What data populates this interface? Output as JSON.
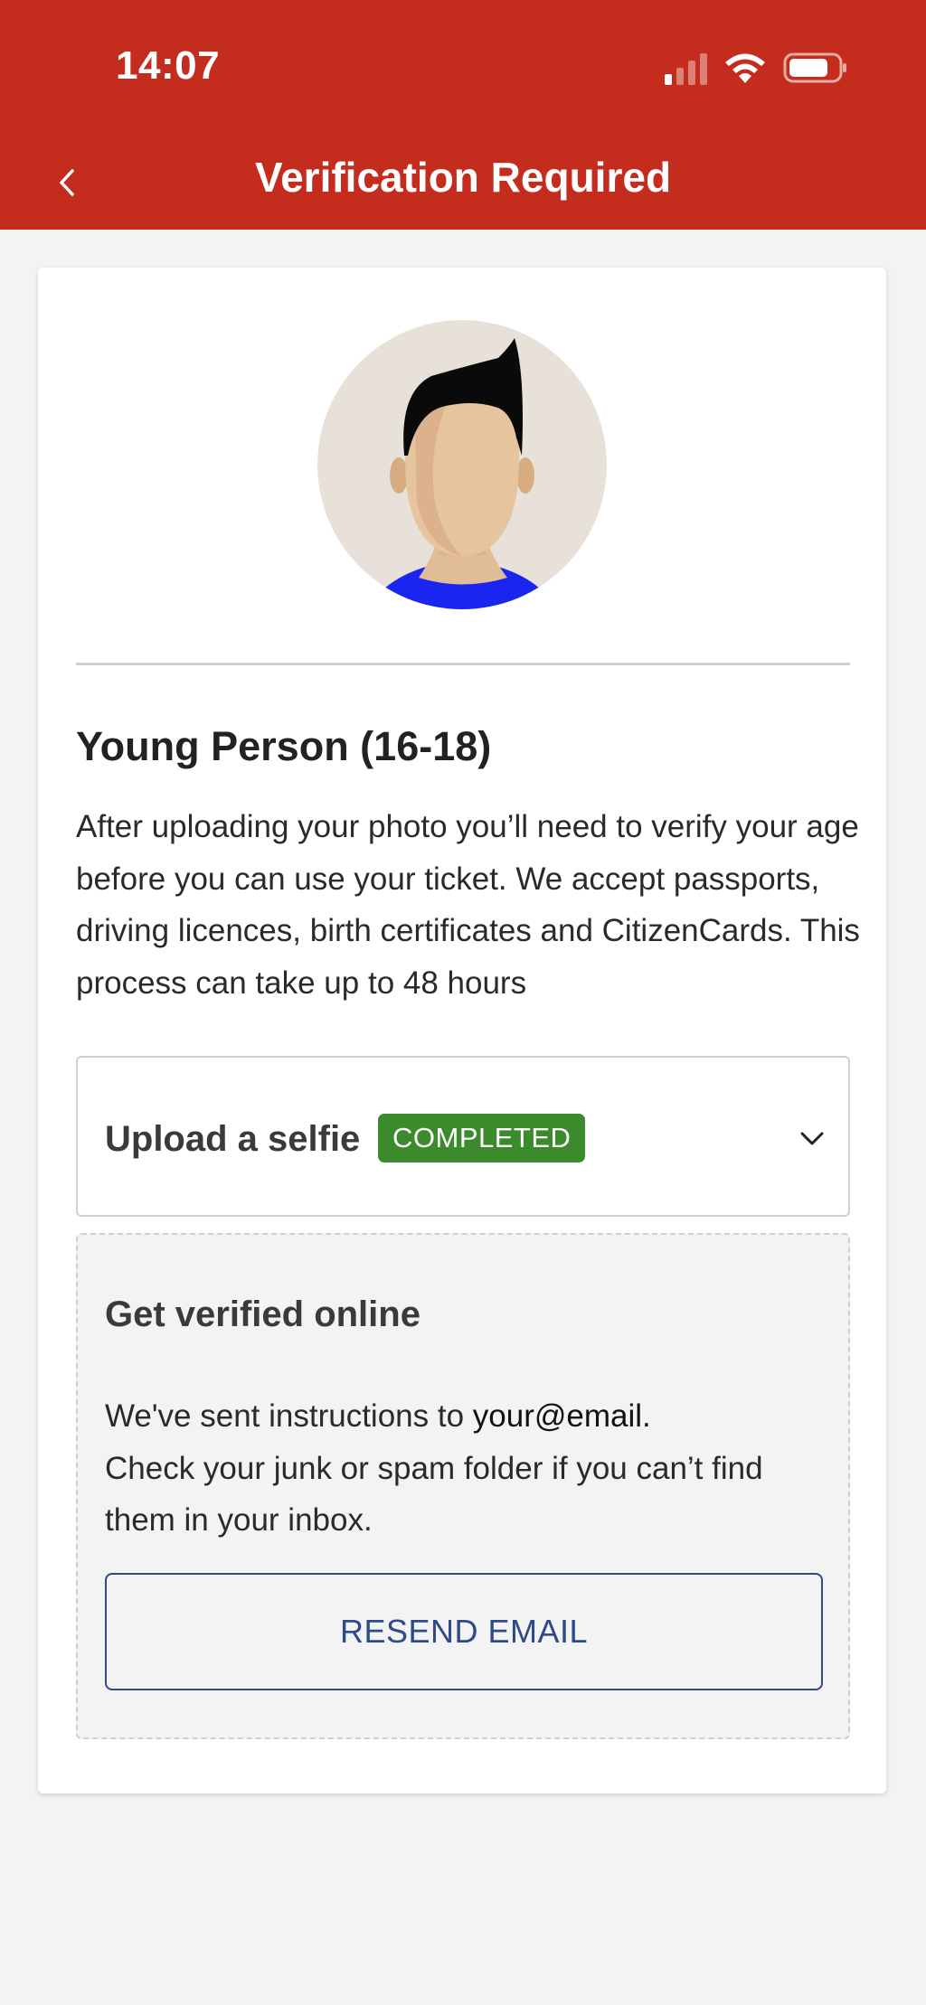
{
  "status_bar": {
    "time": "14:07"
  },
  "nav": {
    "title": "Verification Required",
    "back_icon": "chevron-left-icon"
  },
  "profile": {
    "avatar_icon": "person-avatar"
  },
  "category": {
    "title": "Young Person (16-18)",
    "description": "After uploading your photo you’ll need to verify your age before you can use your ticket. We accept passports, driving licences, birth certificates and CitizenCards. This process can take up to 48 hours"
  },
  "selfie_step": {
    "label": "Upload a selfie",
    "badge": "COMPLETED",
    "badge_color": "#3b8a2b",
    "expand_icon": "chevron-down-icon"
  },
  "online_step": {
    "title": "Get verified online",
    "sent_prefix": "We've sent instructions to ",
    "email": "your@email.",
    "help_text": "Check your junk or spam folder if you can’t find them in your inbox.",
    "resend_label": "RESEND EMAIL"
  },
  "colors": {
    "brand_red": "#c42d1e",
    "accent_blue": "#2d4a8a",
    "background": "#f3f3f3"
  }
}
